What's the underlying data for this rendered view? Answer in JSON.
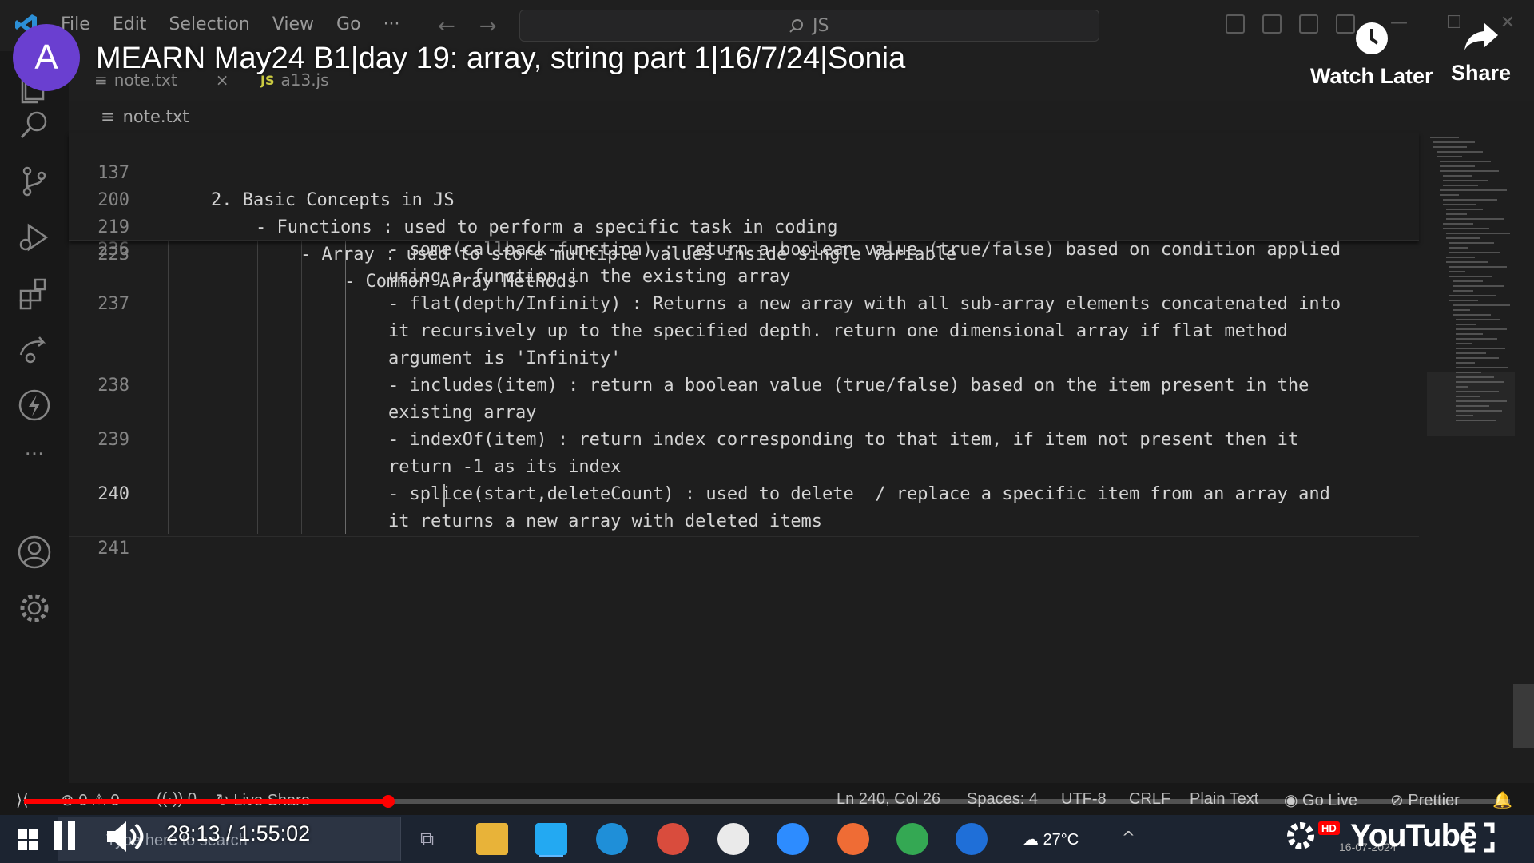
{
  "menu": {
    "items": [
      "File",
      "Edit",
      "Selection",
      "View",
      "Go",
      "···"
    ]
  },
  "command_center": {
    "text": "JS"
  },
  "video": {
    "channel_avatar_letter": "A",
    "title": "MEARN May24 B1|day 19: array, string part 1|16/7/24|Sonia",
    "watch_later": "Watch Later",
    "share": "Share",
    "time": "28:13 / 1:55:02",
    "progress": 0.245,
    "logo": "YouTube",
    "hd": "HD"
  },
  "tabs": [
    {
      "label": "note.txt",
      "close": "×"
    },
    {
      "label": "a13.js",
      "badge": "JS"
    }
  ],
  "breadcrumb": {
    "file": "note.txt"
  },
  "editor": {
    "sticky": [
      {
        "ln": "137",
        "text": "2. Basic Concepts in JS"
      },
      {
        "ln": "200",
        "text": "- Functions : used to perform a specific task in coding"
      },
      {
        "ln": "219",
        "text": "- Array : used to store multiple values inside single Variable"
      },
      {
        "ln": "223",
        "text": "- Common Array Methods"
      }
    ],
    "lines": [
      {
        "ln": "236",
        "text": "- some(callback-function) : return a boolean value (true/false) based on condition applied"
      },
      {
        "ln": "",
        "text": "using a function in the existing array"
      },
      {
        "ln": "237",
        "text": "- flat(depth/Infinity) : Returns a new array with all sub-array elements concatenated into"
      },
      {
        "ln": "",
        "text": "it recursively up to the specified depth. return one dimensional array if flat method"
      },
      {
        "ln": "",
        "text": "argument is 'Infinity'"
      },
      {
        "ln": "238",
        "text": "- includes(item) : return a boolean value (true/false) based on the item present in the"
      },
      {
        "ln": "",
        "text": "existing array"
      },
      {
        "ln": "239",
        "text": "- indexOf(item) : return index corresponding to that item, if item not present then it"
      },
      {
        "ln": "",
        "text": "return -1 as its index"
      },
      {
        "ln": "240",
        "text": "- splice(start,deleteCount) : used to delete  / replace a specific item from an array and"
      },
      {
        "ln": "",
        "text": "it returns a new array with deleted items"
      },
      {
        "ln": "241",
        "text": ""
      }
    ]
  },
  "statusbar": {
    "errors": "0",
    "warnings": "0",
    "ports": "0",
    "live_share": "Live Share",
    "cursor": "Ln 240, Col 26",
    "spaces": "Spaces: 4",
    "encoding": "UTF-8",
    "eol": "CRLF",
    "language": "Plain Text",
    "go_live": "Go Live",
    "prettier": "Prettier"
  },
  "taskbar": {
    "search_placeholder": "Type here to search",
    "weather": "27°C",
    "date": "16-07-2024"
  },
  "colors": {
    "accent": "#ff0000",
    "editor_bg": "#1e1e1e",
    "avatar": "#6a3fd0"
  }
}
